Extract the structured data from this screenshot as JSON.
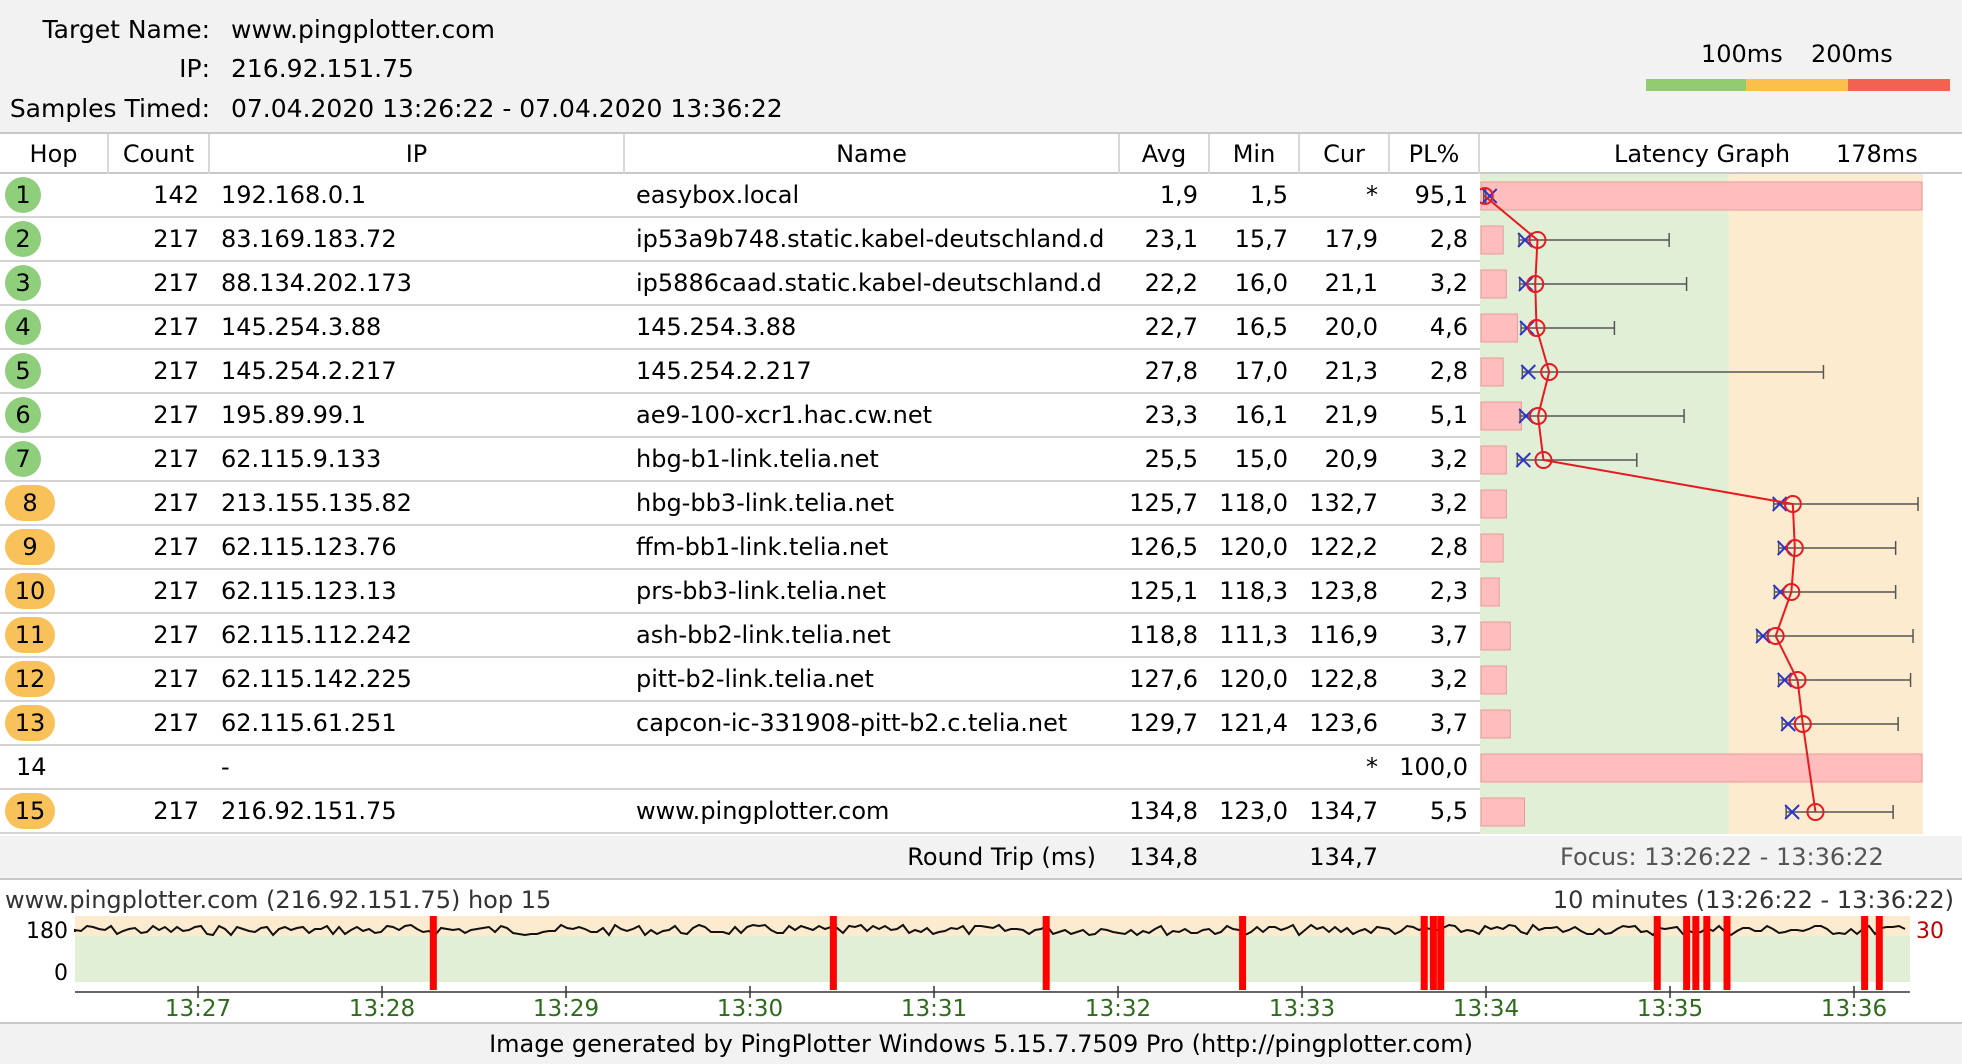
{
  "header": {
    "target_label": "Target Name:",
    "target_value": "www.pingplotter.com",
    "ip_label": "IP:",
    "ip_value": "216.92.151.75",
    "samples_label": "Samples Timed:",
    "samples_value": "07.04.2020 13:26:22 - 07.04.2020 13:36:22",
    "scale_100": "100ms",
    "scale_200": "200ms"
  },
  "colors": {
    "good": "#92cc6f",
    "warn": "#fbbf4e",
    "bad": "#f2634f",
    "loss": "#ff0000",
    "latency_line": "#e8191f",
    "min_mark": "#2d36c8"
  },
  "columns": {
    "hop": "Hop",
    "count": "Count",
    "ip": "IP",
    "name": "Name",
    "avg": "Avg",
    "min": "Min",
    "cur": "Cur",
    "pl": "PL%",
    "graph": "Latency Graph",
    "graph_max": "178ms"
  },
  "hops": [
    {
      "hop": "1",
      "count": "142",
      "ip": "192.168.0.1",
      "name": "easybox.local",
      "avg": "1,9",
      "min": "1,5",
      "cur": "*",
      "pl": "95,1",
      "badge": "green",
      "avg_ms": 1.9,
      "min_ms": 1.5,
      "max_ms": 2.3,
      "loss": 95.1
    },
    {
      "hop": "2",
      "count": "217",
      "ip": "83.169.183.72",
      "name": "ip53a9b748.static.kabel-deutschland.d",
      "avg": "23,1",
      "min": "15,7",
      "cur": "17,9",
      "pl": "2,8",
      "badge": "green",
      "avg_ms": 23.1,
      "min_ms": 15.7,
      "max_ms": 76,
      "loss": 2.8
    },
    {
      "hop": "3",
      "count": "217",
      "ip": "88.134.202.173",
      "name": "ip5886caad.static.kabel-deutschland.d",
      "avg": "22,2",
      "min": "16,0",
      "cur": "21,1",
      "pl": "3,2",
      "badge": "green",
      "avg_ms": 22.2,
      "min_ms": 16.0,
      "max_ms": 83,
      "loss": 3.2
    },
    {
      "hop": "4",
      "count": "217",
      "ip": "145.254.3.88",
      "name": "145.254.3.88",
      "avg": "22,7",
      "min": "16,5",
      "cur": "20,0",
      "pl": "4,6",
      "badge": "green",
      "avg_ms": 22.7,
      "min_ms": 16.5,
      "max_ms": 54,
      "loss": 4.6
    },
    {
      "hop": "5",
      "count": "217",
      "ip": "145.254.2.217",
      "name": "145.254.2.217",
      "avg": "27,8",
      "min": "17,0",
      "cur": "21,3",
      "pl": "2,8",
      "badge": "green",
      "avg_ms": 27.8,
      "min_ms": 17.0,
      "max_ms": 138,
      "loss": 2.8
    },
    {
      "hop": "6",
      "count": "217",
      "ip": "195.89.99.1",
      "name": "ae9-100-xcr1.hac.cw.net",
      "avg": "23,3",
      "min": "16,1",
      "cur": "21,9",
      "pl": "5,1",
      "badge": "green",
      "avg_ms": 23.3,
      "min_ms": 16.1,
      "max_ms": 82,
      "loss": 5.1
    },
    {
      "hop": "7",
      "count": "217",
      "ip": "62.115.9.133",
      "name": "hbg-b1-link.telia.net",
      "avg": "25,5",
      "min": "15,0",
      "cur": "20,9",
      "pl": "3,2",
      "badge": "green",
      "avg_ms": 25.5,
      "min_ms": 15.0,
      "max_ms": 63,
      "loss": 3.2
    },
    {
      "hop": "8",
      "count": "217",
      "ip": "213.155.135.82",
      "name": "hbg-bb3-link.telia.net",
      "avg": "125,7",
      "min": "118,0",
      "cur": "132,7",
      "pl": "3,2",
      "badge": "orange",
      "avg_ms": 125.7,
      "min_ms": 118.0,
      "max_ms": 176,
      "loss": 3.2
    },
    {
      "hop": "9",
      "count": "217",
      "ip": "62.115.123.76",
      "name": "ffm-bb1-link.telia.net",
      "avg": "126,5",
      "min": "120,0",
      "cur": "122,2",
      "pl": "2,8",
      "badge": "orange",
      "avg_ms": 126.5,
      "min_ms": 120.0,
      "max_ms": 167,
      "loss": 2.8
    },
    {
      "hop": "10",
      "count": "217",
      "ip": "62.115.123.13",
      "name": "prs-bb3-link.telia.net",
      "avg": "125,1",
      "min": "118,3",
      "cur": "123,8",
      "pl": "2,3",
      "badge": "orange",
      "avg_ms": 125.1,
      "min_ms": 118.3,
      "max_ms": 167,
      "loss": 2.3
    },
    {
      "hop": "11",
      "count": "217",
      "ip": "62.115.112.242",
      "name": "ash-bb2-link.telia.net",
      "avg": "118,8",
      "min": "111,3",
      "cur": "116,9",
      "pl": "3,7",
      "badge": "orange",
      "avg_ms": 118.8,
      "min_ms": 111.3,
      "max_ms": 174,
      "loss": 3.7
    },
    {
      "hop": "12",
      "count": "217",
      "ip": "62.115.142.225",
      "name": "pitt-b2-link.telia.net",
      "avg": "127,6",
      "min": "120,0",
      "cur": "122,8",
      "pl": "3,2",
      "badge": "orange",
      "avg_ms": 127.6,
      "min_ms": 120.0,
      "max_ms": 173,
      "loss": 3.2
    },
    {
      "hop": "13",
      "count": "217",
      "ip": "62.115.61.251",
      "name": "capcon-ic-331908-pitt-b2.c.telia.net",
      "avg": "129,7",
      "min": "121,4",
      "cur": "123,6",
      "pl": "3,7",
      "badge": "orange",
      "avg_ms": 129.7,
      "min_ms": 121.4,
      "max_ms": 168,
      "loss": 3.7
    },
    {
      "hop": "14",
      "count": "",
      "ip": "-",
      "name": "",
      "avg": "",
      "min": "",
      "cur": "*",
      "pl": "100,0",
      "badge": "none",
      "avg_ms": null,
      "min_ms": null,
      "max_ms": null,
      "loss": 100
    },
    {
      "hop": "15",
      "count": "217",
      "ip": "216.92.151.75",
      "name": "www.pingplotter.com",
      "avg": "134,8",
      "min": "123,0",
      "cur": "134,7",
      "pl": "5,5",
      "badge": "orange",
      "avg_ms": 134.8,
      "min_ms": 123.0,
      "max_ms": 166,
      "loss": 5.5
    }
  ],
  "round_trip": {
    "label": "Round Trip (ms)",
    "avg": "134,8",
    "cur": "134,7",
    "focus": "Focus: 13:26:22 - 13:36:22"
  },
  "timeline": {
    "left_title": "www.pingplotter.com (216.92.151.75) hop 15",
    "right_title": "10 minutes (13:26:22 - 13:36:22)",
    "y_top": "180",
    "y_bottom": "0",
    "right_value": "30",
    "ticks": [
      "13:27",
      "13:28",
      "13:29",
      "13:30",
      "13:31",
      "13:32",
      "13:33",
      "13:34",
      "13:35",
      "13:36"
    ],
    "loss_positions": [
      0.195,
      0.413,
      0.529,
      0.636,
      0.735,
      0.74,
      0.744,
      0.862,
      0.878,
      0.883,
      0.889,
      0.9,
      0.975,
      0.983
    ]
  },
  "footer": "Image generated by PingPlotter Windows 5.15.7.7509 Pro (http://pingplotter.com)"
}
